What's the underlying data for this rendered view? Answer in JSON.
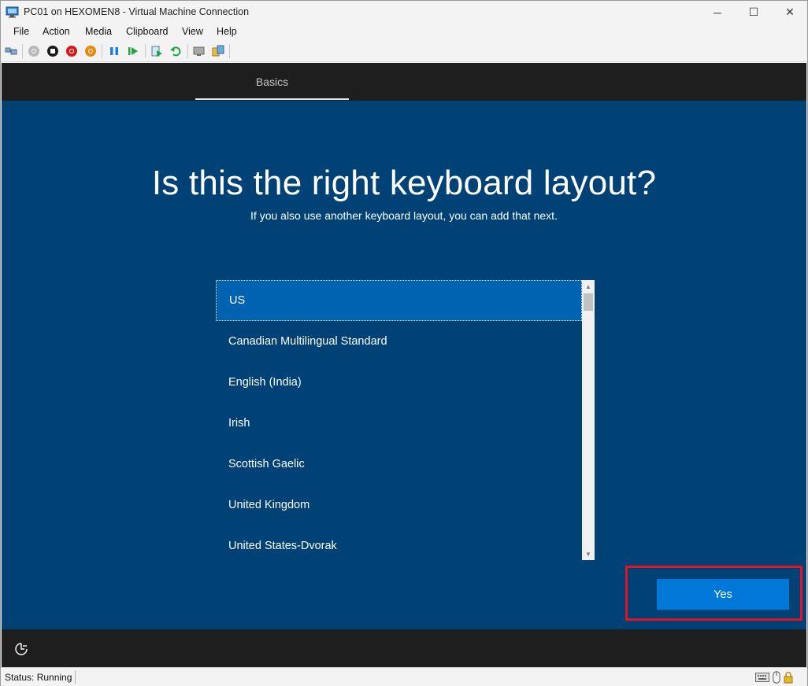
{
  "window": {
    "title": "PC01 on HEXOMEN8 - Virtual Machine Connection",
    "controls": {
      "minimize": "─",
      "maximize": "☐",
      "close": "✕"
    }
  },
  "menu": {
    "items": [
      {
        "label": "File"
      },
      {
        "label": "Action"
      },
      {
        "label": "Media"
      },
      {
        "label": "Clipboard"
      },
      {
        "label": "View"
      },
      {
        "label": "Help"
      }
    ]
  },
  "toolbar": {
    "icons": [
      "ctrl-alt-del-icon",
      "start-icon",
      "turn-off-icon",
      "shut-down-icon",
      "save-state-icon",
      "pause-icon",
      "resume-icon",
      "checkpoint-icon",
      "revert-icon",
      "enhanced-session-icon",
      "share-icon"
    ]
  },
  "oobe": {
    "tab_label": "Basics",
    "heading": "Is this the right keyboard layout?",
    "subheading": "If you also use another keyboard layout, you can add that next.",
    "layouts": [
      {
        "label": "US",
        "selected": true
      },
      {
        "label": "Canadian Multilingual Standard",
        "selected": false
      },
      {
        "label": "English (India)",
        "selected": false
      },
      {
        "label": "Irish",
        "selected": false
      },
      {
        "label": "Scottish Gaelic",
        "selected": false
      },
      {
        "label": "United Kingdom",
        "selected": false
      },
      {
        "label": "United States-Dvorak",
        "selected": false
      }
    ],
    "yes_label": "Yes"
  },
  "status": {
    "text": "Status: Running"
  },
  "colors": {
    "oobe_background": "#004275",
    "selected_row": "#0063b1",
    "primary_button": "#0078d7",
    "highlight_box": "#e81123"
  }
}
